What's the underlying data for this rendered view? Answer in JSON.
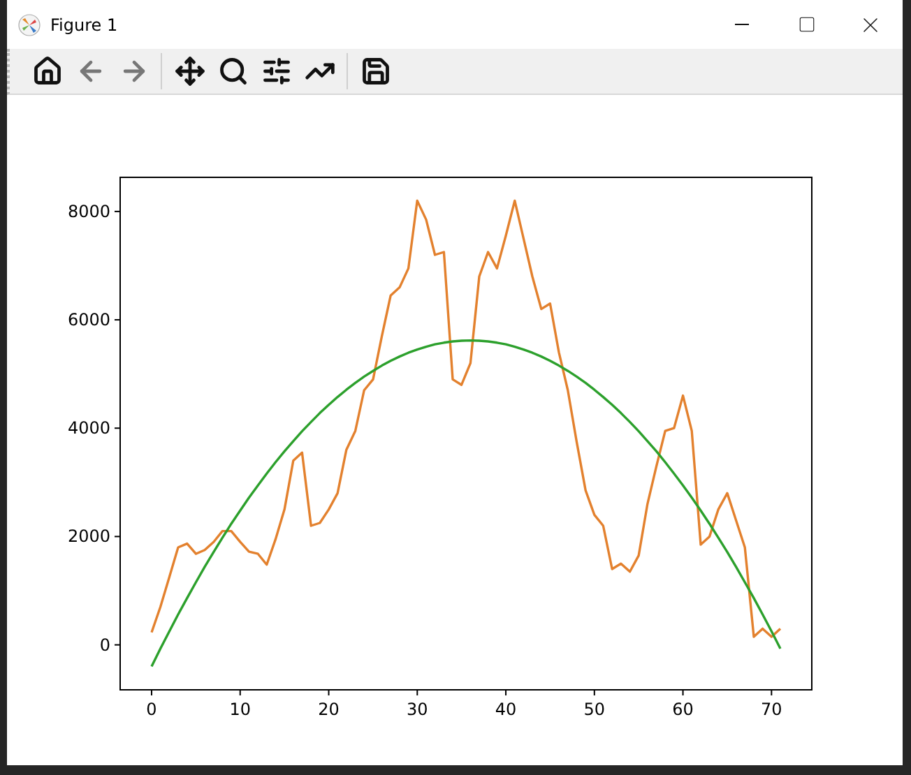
{
  "window": {
    "title": "Figure 1"
  },
  "toolbar": [
    {
      "kind": "home",
      "disabled": false
    },
    {
      "kind": "back",
      "disabled": true
    },
    {
      "kind": "forward",
      "disabled": true
    },
    {
      "kind": "pan",
      "disabled": false
    },
    {
      "kind": "zoom",
      "disabled": false
    },
    {
      "kind": "configure",
      "disabled": false
    },
    {
      "kind": "edit",
      "disabled": false
    },
    {
      "kind": "save",
      "disabled": false
    }
  ],
  "chart_data": {
    "type": "line",
    "xlim": [
      -3.55,
      74.55
    ],
    "ylim": [
      -830,
      8630
    ],
    "xticks": [
      0,
      10,
      20,
      30,
      40,
      50,
      60,
      70
    ],
    "yticks": [
      0,
      2000,
      4000,
      6000,
      8000
    ],
    "x": [
      0,
      1,
      2,
      3,
      4,
      5,
      6,
      7,
      8,
      9,
      10,
      11,
      12,
      13,
      14,
      15,
      16,
      17,
      18,
      19,
      20,
      21,
      22,
      23,
      24,
      25,
      26,
      27,
      28,
      29,
      30,
      31,
      32,
      33,
      34,
      35,
      36,
      37,
      38,
      39,
      40,
      41,
      42,
      43,
      44,
      45,
      46,
      47,
      48,
      49,
      50,
      51,
      52,
      53,
      54,
      55,
      56,
      57,
      58,
      59,
      60,
      61,
      62,
      63,
      64,
      65,
      66,
      67,
      68,
      69,
      70,
      71
    ],
    "series": [
      {
        "color": "#e3812e",
        "values": [
          230,
          700,
          1250,
          1800,
          1870,
          1680,
          1750,
          1900,
          2100,
          2100,
          1900,
          1720,
          1680,
          1480,
          1950,
          2500,
          3400,
          3550,
          2200,
          2250,
          2500,
          2800,
          3600,
          3950,
          4700,
          4900,
          5700,
          6450,
          6600,
          6950,
          8200,
          7850,
          7200,
          7250,
          4900,
          4800,
          5200,
          6800,
          7250,
          6950,
          7550,
          8200,
          7500,
          6800,
          6200,
          6300,
          5400,
          4700,
          3750,
          2850,
          2400,
          2200,
          1400,
          1500,
          1350,
          1650,
          2600,
          3300,
          3950,
          4000,
          4600,
          3950,
          1850,
          2000,
          2500,
          2800,
          2300,
          1800,
          150,
          300,
          150,
          300
        ]
      },
      {
        "color": "#2ca02c",
        "values": [
          -400,
          -70,
          250,
          562,
          864,
          1156,
          1440,
          1714,
          1978,
          2234,
          2480,
          2717,
          2944,
          3163,
          3372,
          3572,
          3762,
          3943,
          4115,
          4278,
          4431,
          4575,
          4710,
          4835,
          4951,
          5058,
          5156,
          5244,
          5323,
          5392,
          5453,
          5504,
          5546,
          5578,
          5601,
          5615,
          5620,
          5615,
          5601,
          5578,
          5546,
          5504,
          5453,
          5392,
          5323,
          5244,
          5156,
          5058,
          4951,
          4835,
          4710,
          4575,
          4431,
          4278,
          4115,
          3943,
          3762,
          3572,
          3372,
          3163,
          2944,
          2717,
          2480,
          2234,
          1978,
          1714,
          1440,
          1156,
          864,
          562,
          250,
          -70
        ]
      }
    ]
  }
}
